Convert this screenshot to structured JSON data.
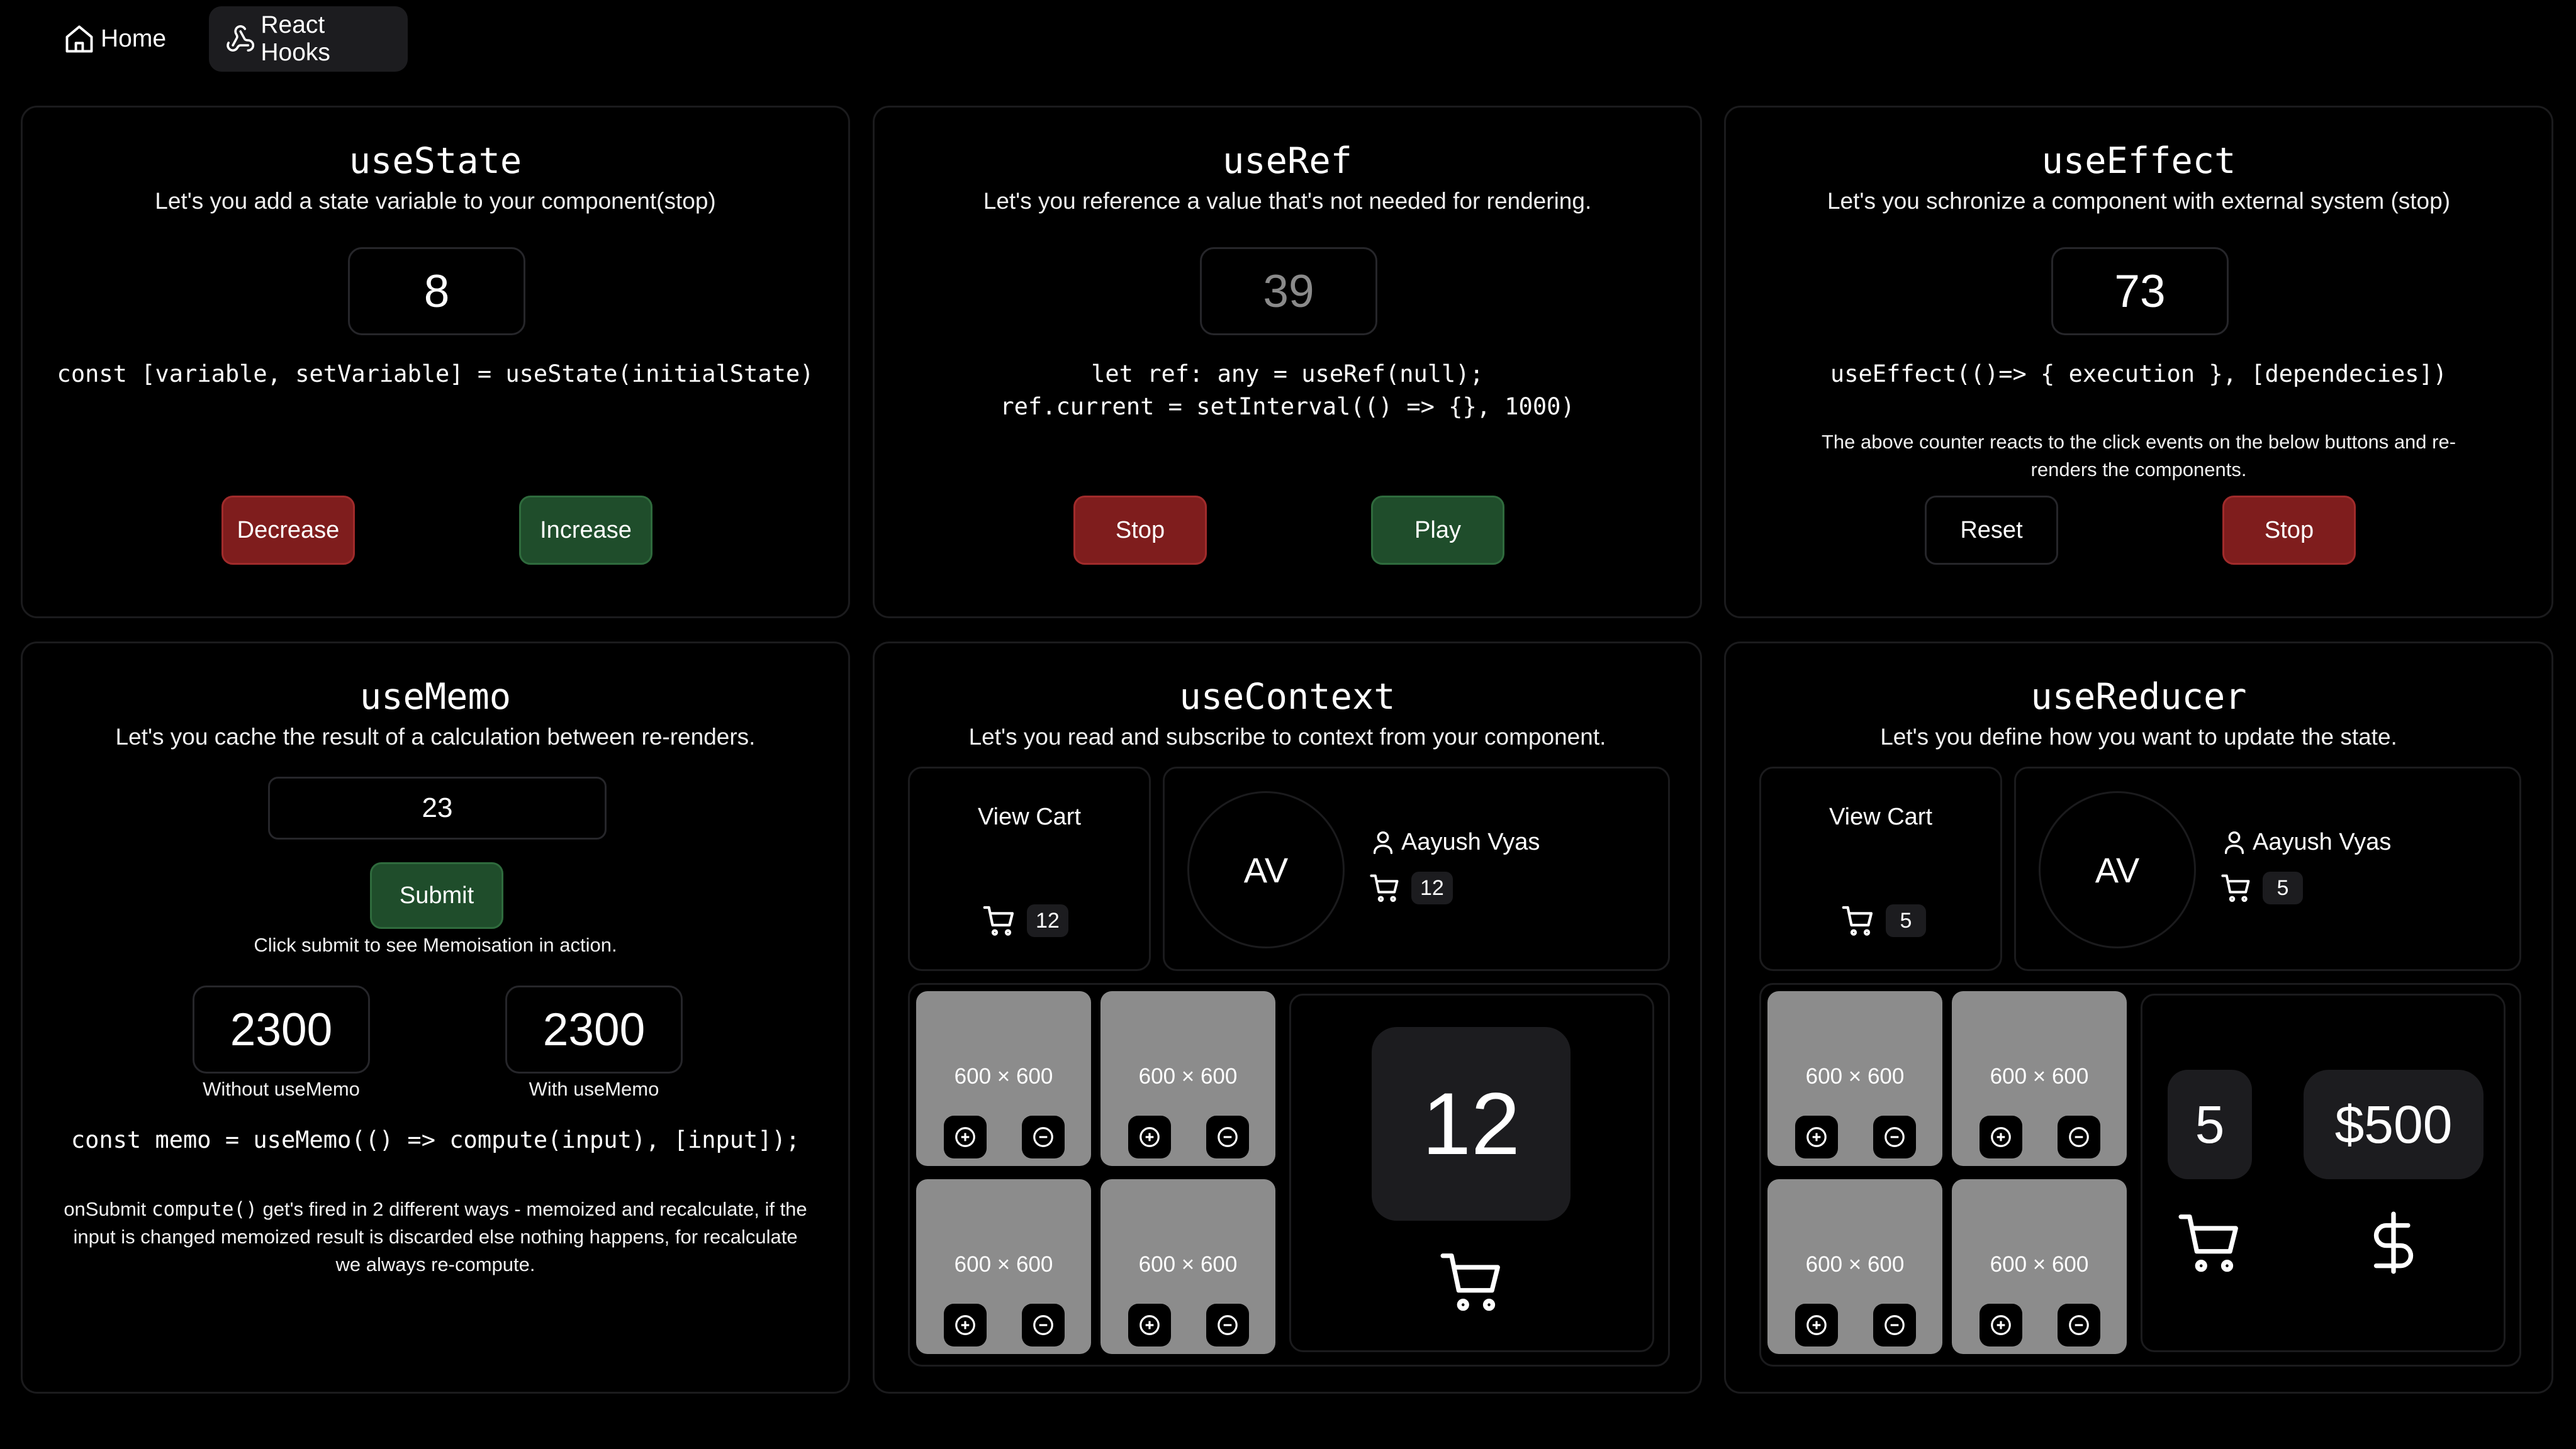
{
  "nav": {
    "home_label": "Home",
    "hooks_label": "React Hooks"
  },
  "useState": {
    "title": "useState",
    "desc": "Let's you add a state variable to your component(stop)",
    "value": "8",
    "code": "const [variable, setVariable] = useState(initialState)",
    "decrease_label": "Decrease",
    "increase_label": "Increase"
  },
  "useRef": {
    "title": "useRef",
    "desc": "Let's you reference a value that's not needed for rendering.",
    "value": "39",
    "code_line1": "let ref: any = useRef(null);",
    "code_line2": "ref.current = setInterval(() => {}, 1000)",
    "stop_label": "Stop",
    "play_label": "Play"
  },
  "useEffect": {
    "title": "useEffect",
    "desc": "Let's you schronize a component with external system (stop)",
    "value": "73",
    "code": "useEffect(()=> { execution }, [dependecies])",
    "note": "The above counter reacts to the click events on the below buttons and re-renders the components.",
    "reset_label": "Reset",
    "stop_label": "Stop"
  },
  "useMemo": {
    "title": "useMemo",
    "desc": "Let's you cache the result of a calculation between re-renders.",
    "input_value": "23",
    "submit_label": "Submit",
    "hint": "Click submit to see Memoisation in action.",
    "without_value": "2300",
    "without_label": "Without useMemo",
    "with_value": "2300",
    "with_label": "With useMemo",
    "code": "const memo = useMemo(() => compute(input), [input]);",
    "note_prefix": "onSubmit ",
    "note_code": "compute()",
    "note_rest": " get's fired in 2 different ways - memoized and recalculate, if the input is changed memoized result is discarded else nothing happens, for recalculate we always re-compute."
  },
  "useContext": {
    "title": "useContext",
    "desc": "Let's you read and subscribe to context from your component.",
    "view_cart_label": "View Cart",
    "cart_count": "12",
    "avatar_initials": "AV",
    "user_name": "Aayush Vyas",
    "user_cart_count": "12",
    "tiles": [
      "600 × 600",
      "600 × 600",
      "600 × 600",
      "600 × 600"
    ],
    "big_count": "12"
  },
  "useReducer": {
    "title": "useReducer",
    "desc": "Let's you define how you want to update the state.",
    "view_cart_label": "View Cart",
    "cart_count": "5",
    "avatar_initials": "AV",
    "user_name": "Aayush Vyas",
    "user_cart_count": "5",
    "tiles": [
      "600 × 600",
      "600 × 600",
      "600 × 600",
      "600 × 600"
    ],
    "item_count": "5",
    "total": "$500"
  },
  "icons": {
    "home": "home-icon",
    "hooks": "webhook-icon",
    "cart": "shopping-cart-icon",
    "user": "user-icon",
    "plus": "plus-circle-icon",
    "minus": "minus-circle-icon",
    "dollar": "dollar-icon"
  },
  "colors": {
    "red_button": "#7f1d1d",
    "green_button": "#1f4d2b",
    "background": "#000000",
    "tile": "#8c8c8c"
  }
}
